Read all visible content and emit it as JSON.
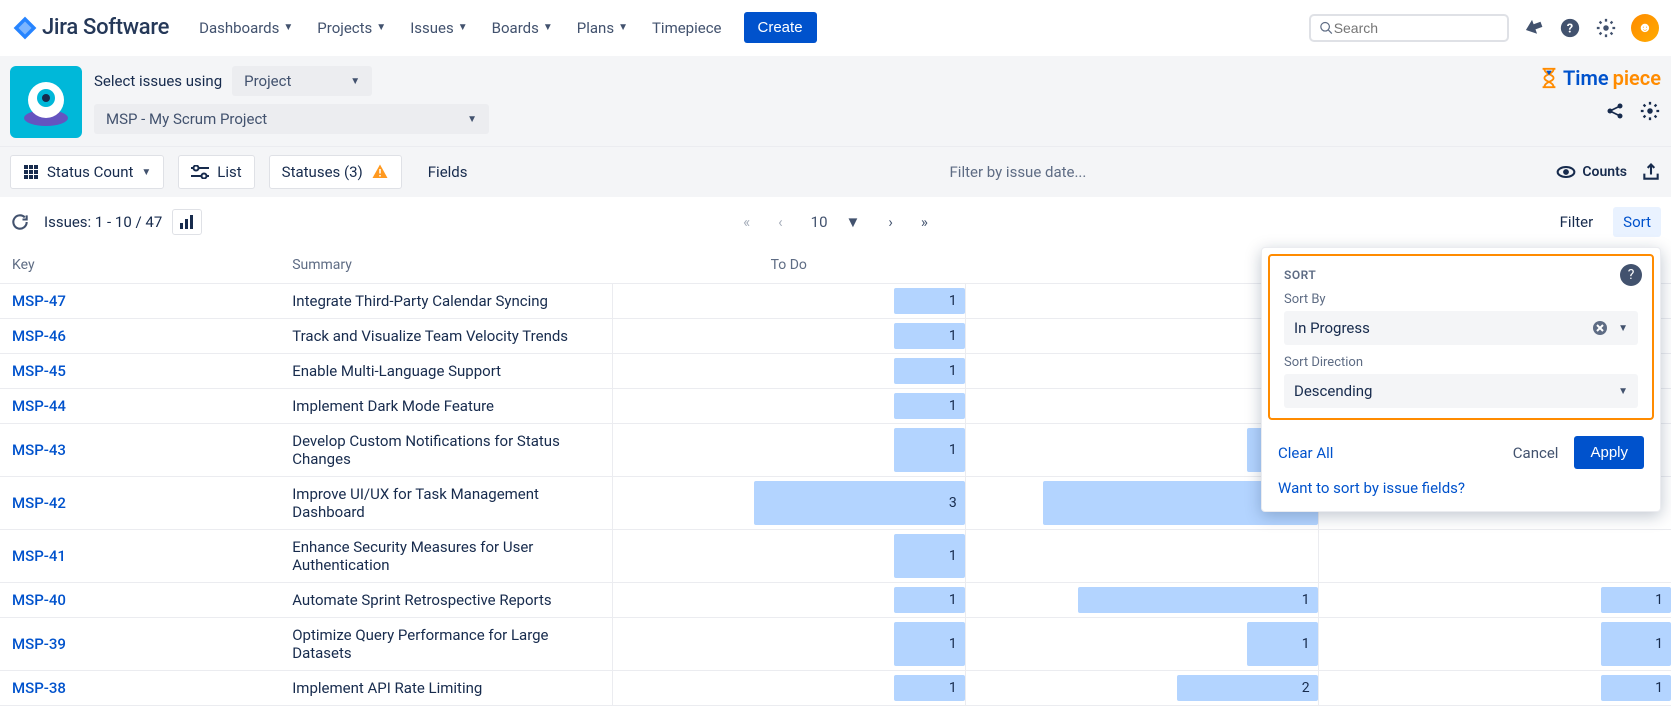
{
  "nav": {
    "logo": "Jira Software",
    "items": [
      "Dashboards",
      "Projects",
      "Issues",
      "Boards",
      "Plans"
    ],
    "timepiece": "Timepiece",
    "create": "Create",
    "search_placeholder": "Search"
  },
  "subheader": {
    "select_label": "Select issues using",
    "scope": "Project",
    "project": "MSP - My Scrum Project",
    "brand1": "Time",
    "brand2": "piece"
  },
  "toolbar": {
    "status_count": "Status Count",
    "list": "List",
    "statuses": "Statuses (3)",
    "fields": "Fields",
    "filter_hint": "Filter by issue date...",
    "counts": "Counts"
  },
  "pager": {
    "issues": "Issues: 1 - 10 / 47",
    "page_size": "10",
    "filter": "Filter",
    "sort": "Sort"
  },
  "columns": {
    "key": "Key",
    "summary": "Summary",
    "todo": "To Do"
  },
  "rows": [
    {
      "key": "MSP-47",
      "summary": "Integrate Third-Party Calendar Syncing",
      "c1": 1,
      "w1": 20
    },
    {
      "key": "MSP-46",
      "summary": "Track and Visualize Team Velocity Trends",
      "c1": 1,
      "w1": 20
    },
    {
      "key": "MSP-45",
      "summary": "Enable Multi-Language Support",
      "c1": 1,
      "w1": 20
    },
    {
      "key": "MSP-44",
      "summary": "Implement Dark Mode Feature",
      "c1": 1,
      "w1": 20
    },
    {
      "key": "MSP-43",
      "summary": "Develop Custom Notifications for Status Changes",
      "c1": 1,
      "w1": 20,
      "c2": null,
      "w2": 20,
      "bar2": true
    },
    {
      "key": "MSP-42",
      "summary": "Improve UI/UX for Task Management Dashboard",
      "c1": 3,
      "w1": 60,
      "c2": null,
      "w2": 78,
      "bar2": true
    },
    {
      "key": "MSP-41",
      "summary": "Enhance Security Measures for User Authentication",
      "c1": 1,
      "w1": 20
    },
    {
      "key": "MSP-40",
      "summary": "Automate Sprint Retrospective Reports",
      "c1": 1,
      "w1": 20,
      "c2": 1,
      "w2": 68,
      "c3": 1,
      "w3": 20
    },
    {
      "key": "MSP-39",
      "summary": "Optimize Query Performance for Large Datasets",
      "c1": 1,
      "w1": 20,
      "c2": 1,
      "w2": 20,
      "c3": 1,
      "w3": 20
    },
    {
      "key": "MSP-38",
      "summary": "Implement API Rate Limiting",
      "c1": 1,
      "w1": 20,
      "c2": 2,
      "w2": 40,
      "c3": 1,
      "w3": 20
    }
  ],
  "sort_popup": {
    "title": "SORT",
    "sort_by_label": "Sort By",
    "sort_by_value": "In Progress",
    "direction_label": "Sort Direction",
    "direction_value": "Descending",
    "clear": "Clear All",
    "cancel": "Cancel",
    "apply": "Apply",
    "want_link": "Want to sort by issue fields?"
  }
}
